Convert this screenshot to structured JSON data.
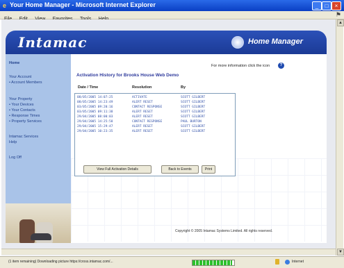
{
  "browser": {
    "title": "Your Home Manager - Microsoft Internet Explorer",
    "menu": [
      "File",
      "Edit",
      "View",
      "Favorites",
      "Tools",
      "Help"
    ],
    "status_text": "(1 item remaining) Downloading picture https://cross.intamac.com/...",
    "progress": 0.95,
    "zone": "Internet"
  },
  "header": {
    "logo": "Intamac",
    "title": "Home Manager"
  },
  "sidebar": {
    "items": [
      "Home",
      "Your Account",
      "• Account Members",
      "Your Property",
      "• Your Devices",
      "• Your Contacts",
      "• Response Times",
      "• Property Services",
      "Intamac Services",
      "Help",
      "Log Off"
    ]
  },
  "main": {
    "info_text": "For more information click the icon",
    "history_title": "Activation History for Brooks House Web Demo",
    "columns": [
      "Date / Time",
      "Resolution",
      "By"
    ],
    "rows": [
      [
        "08/05/2005 14:07:25",
        "ACTIVATE",
        "SCOTT GILBERT"
      ],
      [
        "08/05/2005 14:23:49",
        "ALERT RESET",
        "SCOTT GILBERT"
      ],
      [
        "03/05/2005 09:20:16",
        "CONTACT RESPONSE",
        "SCOTT GILBERT"
      ],
      [
        "03/05/2005 09:11:38",
        "ALERT RESET",
        "SCOTT GILBERT"
      ],
      [
        "29/04/2005 08:00:03",
        "ALERT RESET",
        "SCOTT GILBERT"
      ],
      [
        "29/04/2005 14:25:58",
        "CONTACT RESPONSE",
        "PAUL BURTON"
      ],
      [
        "29/04/2005 15:29:47",
        "ALERT RESET",
        "SCOTT GILBERT"
      ],
      [
        "29/04/2005 10:23:35",
        "ALERT RESET",
        "SCOTT GILBERT"
      ]
    ],
    "buttons": {
      "view_details": "View Full Activation Details",
      "back": "Back to Events",
      "print": "Print"
    },
    "copyright": "Copyright © 2005 Intamac Systems Limited. All rights reserved."
  },
  "colors": {
    "header_blue": "#1f46a8",
    "sidebar_blue": "#a9c3e8",
    "title_text": "#2e3a9c"
  }
}
